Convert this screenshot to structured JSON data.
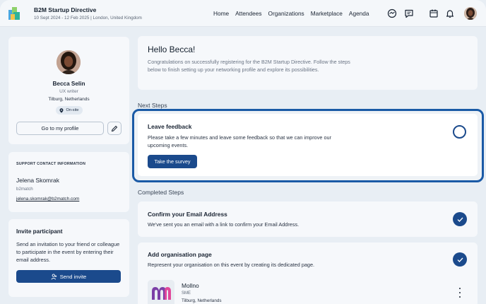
{
  "header": {
    "event_title": "B2M Startup Directive",
    "event_subtitle": "10 Sept 2024 - 12 Feb 2025 | London, United Kingdom",
    "nav": [
      "Home",
      "Attendees",
      "Organizations",
      "Marketplace",
      "Agenda"
    ],
    "icons": [
      "handshake-icon",
      "chat-icon",
      "calendar-icon",
      "bell-icon",
      "user-avatar"
    ]
  },
  "profile": {
    "name": "Becca Selin",
    "role": "UX writer",
    "location": "Tilburg, Netherlands",
    "badge": "On-site",
    "profile_button": "Go to my profile"
  },
  "support": {
    "heading": "SUPPORT CONTACT INFORMATION",
    "name": "Jelena Skomrak",
    "org": "b2match",
    "email": "jelena.skomrak@b2match.com"
  },
  "invite": {
    "title": "Invite participant",
    "description": "Send an invitation to your friend or colleague to participate in the event by entering their email address.",
    "button": "Send invite"
  },
  "hello": {
    "title": "Hello Becca!",
    "description": "Congratulations on successfully registering for the B2M Startup Directive. Follow the steps below to finish setting up your networking profile and explore its possibilities."
  },
  "next_steps": {
    "label": "Next Steps",
    "title": "Leave feedback",
    "description": "Please take a few minutes and leave some feedback so that we can improve our upcoming events.",
    "button": "Take the survey"
  },
  "completed": {
    "label": "Completed Steps",
    "items": [
      {
        "title": "Confirm your Email Address",
        "description": "We've sent you an email with a link to confirm your Email Address."
      },
      {
        "title": "Add organisation page",
        "description": "Represent your organisation on this event by creating its dedicated page."
      }
    ],
    "organization": {
      "name": "Mollno",
      "type": "SME",
      "location": "Tilburg, Netherlands"
    }
  },
  "colors": {
    "primary": "#1b4a8c",
    "highlight_border": "#1a5aa6",
    "background": "#e8eef4"
  }
}
